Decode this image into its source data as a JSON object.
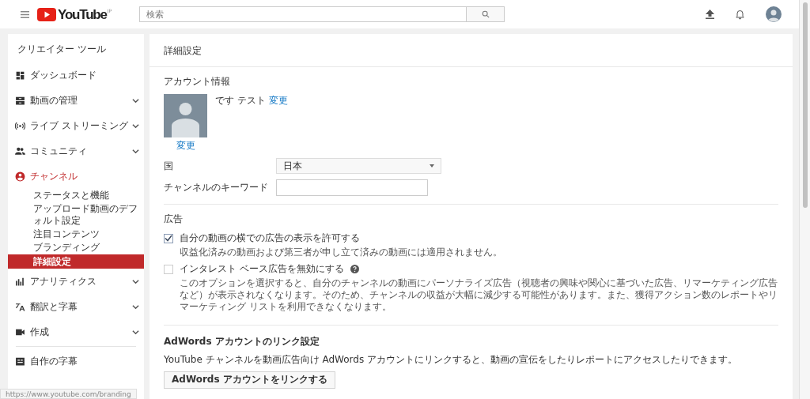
{
  "header": {
    "logo": "YouTube",
    "logo_region": "JP",
    "search": {
      "placeholder": "検索"
    }
  },
  "sidebar": {
    "title": "クリエイター ツール",
    "items": [
      {
        "label": "ダッシュボード",
        "selected": false
      },
      {
        "label": "動画の管理",
        "selected": false,
        "expanded": false
      },
      {
        "label": "ライブ ストリーミング",
        "selected": false,
        "expanded": false
      },
      {
        "label": "コミュニティ",
        "selected": false,
        "expanded": false
      },
      {
        "label": "チャンネル",
        "selected": true,
        "expanded": true,
        "children": [
          {
            "label": "ステータスと機能",
            "selected": false
          },
          {
            "label": "アップロード動画のデフォルト設定",
            "selected": false
          },
          {
            "label": "注目コンテンツ",
            "selected": false
          },
          {
            "label": "ブランディング",
            "selected": false
          },
          {
            "label": "詳細設定",
            "selected": true
          }
        ]
      },
      {
        "label": "アナリティクス",
        "selected": false,
        "expanded": false
      },
      {
        "label": "翻訳と字幕",
        "selected": false,
        "expanded": false
      },
      {
        "label": "作成",
        "selected": false,
        "expanded": false
      },
      {
        "label": "自作の字幕",
        "selected": false
      }
    ]
  },
  "main": {
    "title": "詳細設定",
    "account": {
      "heading": "アカウント情報",
      "name": "です テスト",
      "name_link": "変更",
      "avatar_link": "変更",
      "country": {
        "label": "国",
        "value": "日本"
      },
      "keywords": {
        "label": "チャンネルのキーワード"
      }
    },
    "ads": {
      "heading": "広告",
      "options": [
        {
          "label": "自分の動画の横での広告の表示を許可する",
          "checked": true,
          "help": false,
          "description": "収益化済みの動画および第三者が申し立て済みの動画には適用されません。"
        },
        {
          "label": "インタレスト ベース広告を無効にする",
          "checked": false,
          "help": true,
          "description": "このオプションを選択すると、自分のチャンネルの動画にパーソナライズ広告（視聴者の興味や関心に基づいた広告、リマーケティング広告など）が表示されなくなります。そのため、チャンネルの収益が大幅に減少する可能性があります。また、獲得アクション数のレポートやリマーケティング リストを利用できなくなります。"
        }
      ]
    },
    "adwords": {
      "heading": "AdWords アカウントのリンク設定",
      "description": "YouTube チャンネルを動画広告向け AdWords アカウントにリンクすると、動画の宣伝をしたりレポートにアクセスしたりできます。",
      "button": "AdWords アカウントをリンクする"
    }
  },
  "status_url": "https://www.youtube.com/branding"
}
